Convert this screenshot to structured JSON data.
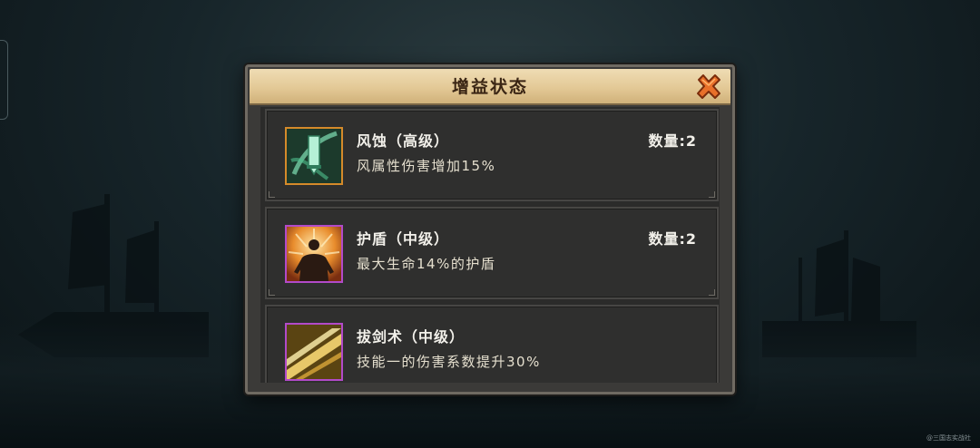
{
  "dialog": {
    "title": "增益状态",
    "close_icon": "close-x-icon"
  },
  "buffs": [
    {
      "name": "风蚀（高级）",
      "description": "风属性伤害增加15%",
      "count_label": "数量:",
      "count_value": "2",
      "icon": "wind-sword-icon",
      "frame_color": "#d58a2a"
    },
    {
      "name": "护盾（中级）",
      "description": "最大生命14%的护盾",
      "count_label": "数量:",
      "count_value": "2",
      "icon": "shield-body-icon",
      "frame_color": "#b24ac9"
    },
    {
      "name": "拔剑术（中级）",
      "description": "技能一的伤害系数提升30%",
      "icon": "sword-draw-icon",
      "frame_color": "#b24ac9"
    }
  ],
  "colors": {
    "header": "#e3c996",
    "title_text": "#3a2514",
    "panel": "#3b3a38",
    "card": "#2f2f2e"
  },
  "watermark": "@三国志实战社"
}
